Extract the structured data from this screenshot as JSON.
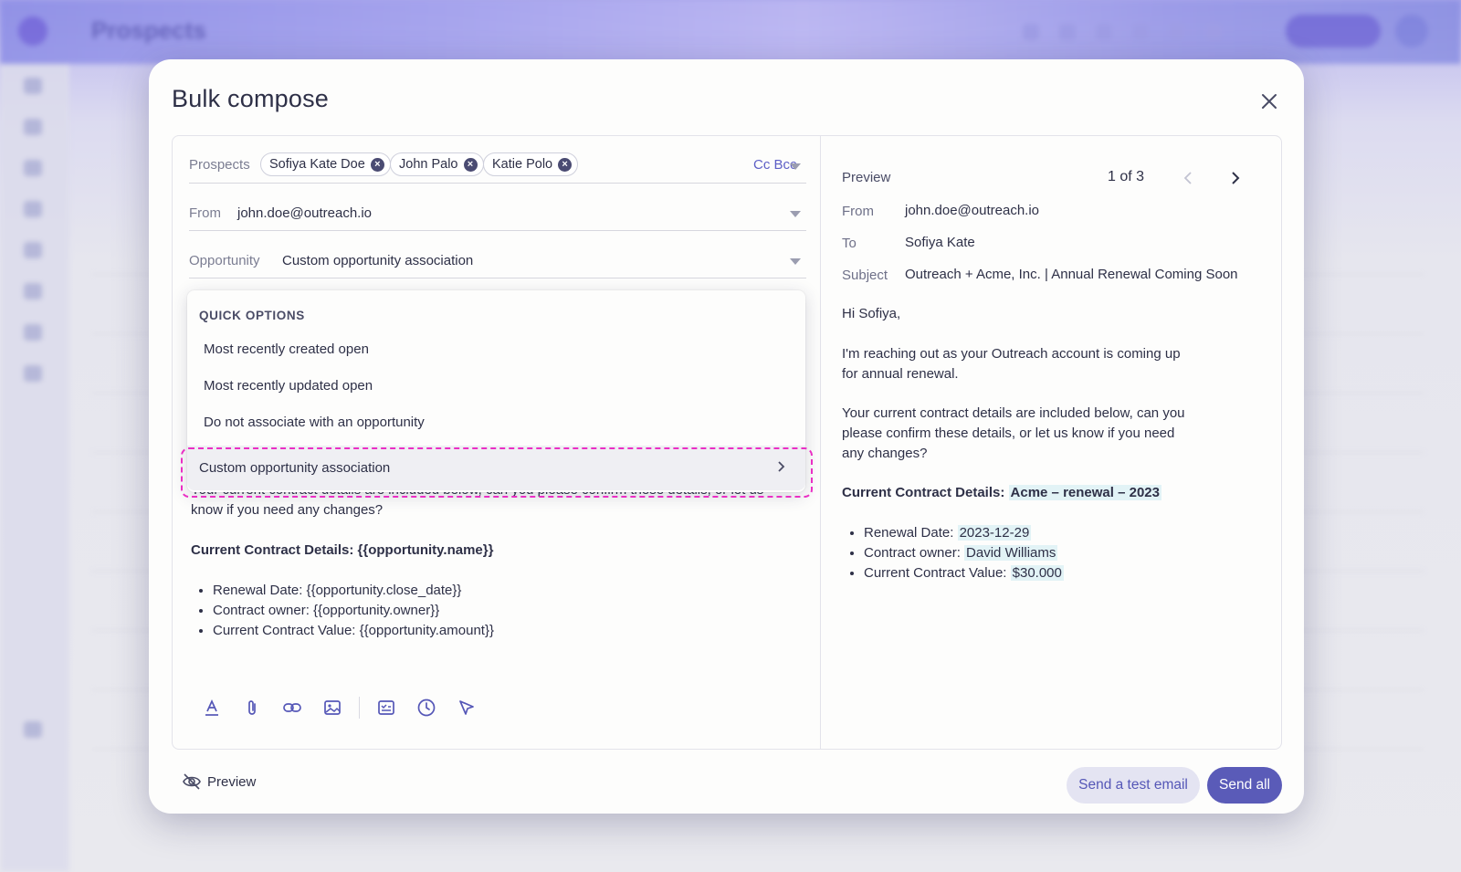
{
  "background": {
    "app_title": "Prospects"
  },
  "modal": {
    "title": "Bulk compose"
  },
  "compose": {
    "prospects_label": "Prospects",
    "prospects": [
      {
        "name": "Sofiya Kate Doe"
      },
      {
        "name": "John Palo"
      },
      {
        "name": "Katie Polo"
      }
    ],
    "cc_bcc": "Cc Bcc",
    "from_label": "From",
    "from_value": "john.doe@outreach.io",
    "opportunity_label": "Opportunity",
    "opportunity_value": "Custom opportunity association",
    "body_partial_line1": "Your current contract details are included below, can you please confirm these details, or let us",
    "body_partial_line2": "know if you need any changes?",
    "details_heading": "Current Contract Details: {{opportunity.name}}",
    "bullets": [
      "Renewal Date: {{opportunity.close_date}}",
      "Contract owner: {{opportunity.owner}}",
      "Current Contract Value: {{opportunity.amount}}"
    ],
    "toolbar_icons": [
      "text-format-icon",
      "attachment-icon",
      "link-icon",
      "image-icon",
      "snippet-icon",
      "schedule-icon",
      "send-later-icon"
    ]
  },
  "dropdown": {
    "heading": "QUICK OPTIONS",
    "options": [
      "Most recently created open",
      "Most recently updated open",
      "Do not associate with an opportunity"
    ],
    "selected": "Custom opportunity association",
    "highlight_color": "#ea2fc4"
  },
  "preview": {
    "label": "Preview",
    "pager": "1 of 3",
    "from_label": "From",
    "from_value": "john.doe@outreach.io",
    "to_label": "To",
    "to_value": "Sofiya Kate",
    "subject_label": "Subject",
    "subject_value": "Outreach + Acme, Inc. | Annual Renewal Coming Soon",
    "greeting": "Hi Sofiya,",
    "para1_line1": "I'm reaching out as your Outreach account is coming up",
    "para1_line2": "for annual renewal.",
    "para2_line1": "Your current contract details are included below, can you",
    "para2_line2": "please confirm these details, or let us know if you need",
    "para2_line3": "any changes?",
    "details_prefix": "Current Contract Details: ",
    "details_value": "Acme – renewal – 2023",
    "bullets": [
      {
        "label": "Renewal Date: ",
        "value": "2023-12-29"
      },
      {
        "label": "Contract owner: ",
        "value": "David Williams"
      },
      {
        "label": "Current Contract Value: ",
        "value": "$30.000"
      }
    ],
    "highlight_color": "#e2f3f6"
  },
  "footer": {
    "preview_toggle": "Preview",
    "send_test": "Send a test email",
    "send_all": "Send all"
  },
  "colors": {
    "accent": "#5a5bb8",
    "secondary_button": "#e4e4f2"
  }
}
